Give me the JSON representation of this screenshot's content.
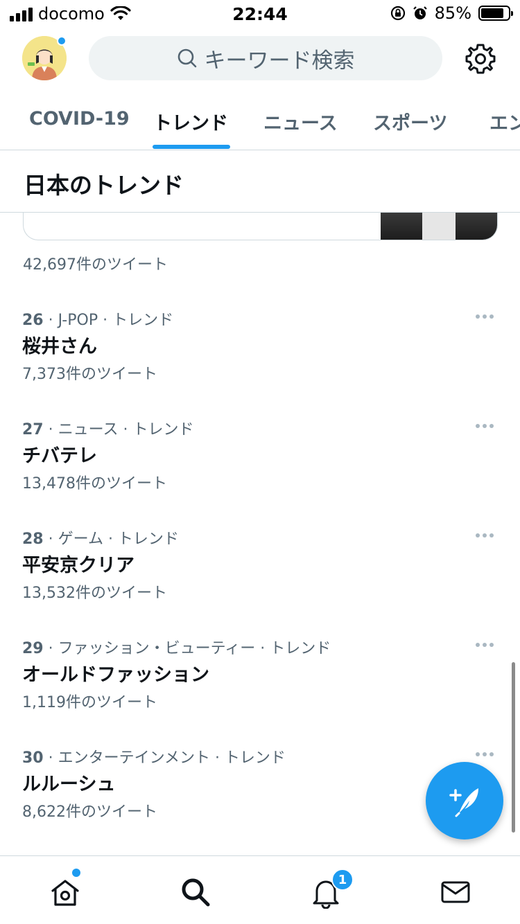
{
  "status_bar": {
    "carrier": "docomo",
    "time": "22:44",
    "battery": "85%"
  },
  "header": {
    "search_placeholder": "キーワード検索"
  },
  "tabs": [
    {
      "label": "COVID-19",
      "active": false
    },
    {
      "label": "トレンド",
      "active": true
    },
    {
      "label": "ニュース",
      "active": false
    },
    {
      "label": "スポーツ",
      "active": false
    },
    {
      "label": "エン",
      "active": false
    }
  ],
  "section": {
    "title": "日本のトレンド",
    "previous_count": "42,697件のツイート"
  },
  "trends": [
    {
      "rank": "26",
      "category": " · J-POP · トレンド",
      "name": "桜井さん",
      "count": "7,373件のツイート"
    },
    {
      "rank": "27",
      "category": " · ニュース · トレンド",
      "name": "チバテレ",
      "count": "13,478件のツイート"
    },
    {
      "rank": "28",
      "category": " · ゲーム · トレンド",
      "name": "平安京クリア",
      "count": "13,532件のツイート"
    },
    {
      "rank": "29",
      "category": " · ファッション・ビューティー · トレンド",
      "name": "オールドファッション",
      "count": "1,119件のツイート"
    },
    {
      "rank": "30",
      "category": " · エンターテインメント · トレンド",
      "name": "ルルーシュ",
      "count": "8,622件のツイート"
    }
  ],
  "bottom_nav": {
    "notification_badge": "1"
  },
  "colors": {
    "accent": "#1d9bf0",
    "secondary_text": "#536471",
    "primary_text": "#0f1419"
  }
}
